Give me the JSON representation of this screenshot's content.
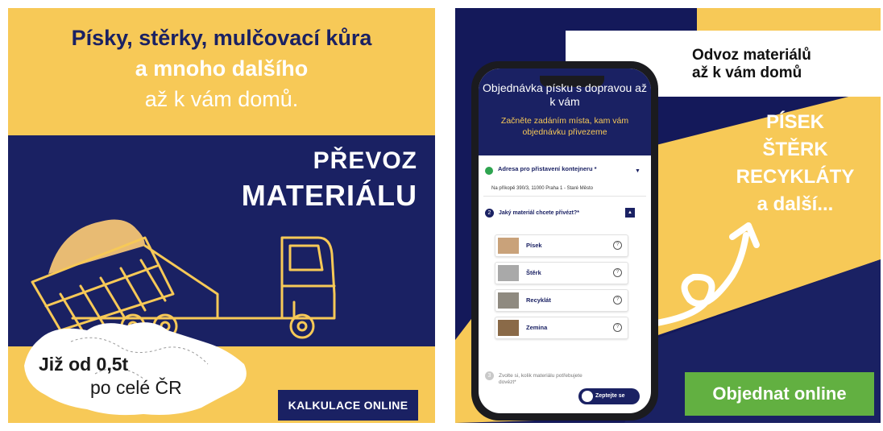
{
  "left": {
    "headline_1": "Písky, stěrky, mulčovací kůra",
    "headline_2": "a mnoho dalšího",
    "headline_3": "až k vám domů.",
    "title_1": "PŘEVOZ",
    "title_2": "MATERIÁLU",
    "price_1": "Již od 0,5t",
    "price_2": "po celé ČR",
    "cta": "KALKULACE ONLINE"
  },
  "right": {
    "box_line_1": "Odvoz materiálů",
    "box_line_2": "až k vám domů",
    "list": [
      "PÍSEK",
      "ŠTĚRK",
      "RECYKLÁTY",
      "a další..."
    ],
    "cta": "Objednat online",
    "phone": {
      "title": "Objednávka písku s dopravou až k vám",
      "subtitle": "Začněte zadáním místa, kam vám objednávku přivezeme",
      "step1_label": "Adresa pro přistavení kontejneru *",
      "step1_value": "Na příkopě 390/3, 11000 Praha 1 - Staré Město",
      "step2_number": "2",
      "step2_label": "Jaký materiál chcete přivézt?*",
      "materials": [
        "Písek",
        "Štěrk",
        "Recyklát",
        "Zemina"
      ],
      "step3_number": "3",
      "step3_label": "Zvolte si, kolik materiálu potřebujete dovézt*",
      "chat_label": "Zeptejte se"
    }
  },
  "colors": {
    "yellow": "#f7c957",
    "navy": "#1a2163",
    "green": "#62b041",
    "white": "#ffffff"
  },
  "icons": [
    "truck-illustration",
    "czech-map-outline",
    "curved-arrow-icon",
    "check-icon",
    "info-icon",
    "chat-icon"
  ]
}
